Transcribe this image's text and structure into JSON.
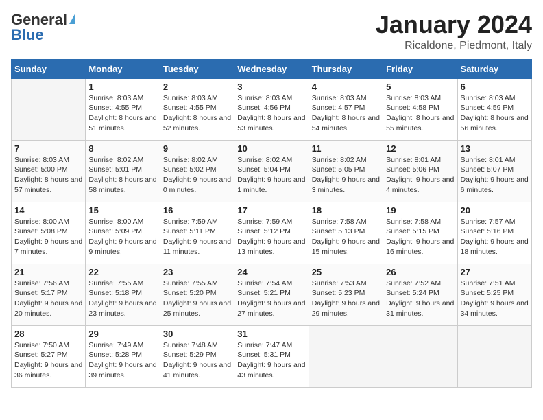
{
  "logo": {
    "general": "General",
    "blue": "Blue",
    "tagline": "GeneralBlue"
  },
  "header": {
    "month": "January 2024",
    "location": "Ricaldone, Piedmont, Italy"
  },
  "weekdays": [
    "Sunday",
    "Monday",
    "Tuesday",
    "Wednesday",
    "Thursday",
    "Friday",
    "Saturday"
  ],
  "weeks": [
    [
      {
        "day": "",
        "sunrise": "",
        "sunset": "",
        "daylight": "",
        "empty": true
      },
      {
        "day": "1",
        "sunrise": "Sunrise: 8:03 AM",
        "sunset": "Sunset: 4:55 PM",
        "daylight": "Daylight: 8 hours and 51 minutes.",
        "empty": false
      },
      {
        "day": "2",
        "sunrise": "Sunrise: 8:03 AM",
        "sunset": "Sunset: 4:55 PM",
        "daylight": "Daylight: 8 hours and 52 minutes.",
        "empty": false
      },
      {
        "day": "3",
        "sunrise": "Sunrise: 8:03 AM",
        "sunset": "Sunset: 4:56 PM",
        "daylight": "Daylight: 8 hours and 53 minutes.",
        "empty": false
      },
      {
        "day": "4",
        "sunrise": "Sunrise: 8:03 AM",
        "sunset": "Sunset: 4:57 PM",
        "daylight": "Daylight: 8 hours and 54 minutes.",
        "empty": false
      },
      {
        "day": "5",
        "sunrise": "Sunrise: 8:03 AM",
        "sunset": "Sunset: 4:58 PM",
        "daylight": "Daylight: 8 hours and 55 minutes.",
        "empty": false
      },
      {
        "day": "6",
        "sunrise": "Sunrise: 8:03 AM",
        "sunset": "Sunset: 4:59 PM",
        "daylight": "Daylight: 8 hours and 56 minutes.",
        "empty": false
      }
    ],
    [
      {
        "day": "7",
        "sunrise": "Sunrise: 8:03 AM",
        "sunset": "Sunset: 5:00 PM",
        "daylight": "Daylight: 8 hours and 57 minutes.",
        "empty": false
      },
      {
        "day": "8",
        "sunrise": "Sunrise: 8:02 AM",
        "sunset": "Sunset: 5:01 PM",
        "daylight": "Daylight: 8 hours and 58 minutes.",
        "empty": false
      },
      {
        "day": "9",
        "sunrise": "Sunrise: 8:02 AM",
        "sunset": "Sunset: 5:02 PM",
        "daylight": "Daylight: 9 hours and 0 minutes.",
        "empty": false
      },
      {
        "day": "10",
        "sunrise": "Sunrise: 8:02 AM",
        "sunset": "Sunset: 5:04 PM",
        "daylight": "Daylight: 9 hours and 1 minute.",
        "empty": false
      },
      {
        "day": "11",
        "sunrise": "Sunrise: 8:02 AM",
        "sunset": "Sunset: 5:05 PM",
        "daylight": "Daylight: 9 hours and 3 minutes.",
        "empty": false
      },
      {
        "day": "12",
        "sunrise": "Sunrise: 8:01 AM",
        "sunset": "Sunset: 5:06 PM",
        "daylight": "Daylight: 9 hours and 4 minutes.",
        "empty": false
      },
      {
        "day": "13",
        "sunrise": "Sunrise: 8:01 AM",
        "sunset": "Sunset: 5:07 PM",
        "daylight": "Daylight: 9 hours and 6 minutes.",
        "empty": false
      }
    ],
    [
      {
        "day": "14",
        "sunrise": "Sunrise: 8:00 AM",
        "sunset": "Sunset: 5:08 PM",
        "daylight": "Daylight: 9 hours and 7 minutes.",
        "empty": false
      },
      {
        "day": "15",
        "sunrise": "Sunrise: 8:00 AM",
        "sunset": "Sunset: 5:09 PM",
        "daylight": "Daylight: 9 hours and 9 minutes.",
        "empty": false
      },
      {
        "day": "16",
        "sunrise": "Sunrise: 7:59 AM",
        "sunset": "Sunset: 5:11 PM",
        "daylight": "Daylight: 9 hours and 11 minutes.",
        "empty": false
      },
      {
        "day": "17",
        "sunrise": "Sunrise: 7:59 AM",
        "sunset": "Sunset: 5:12 PM",
        "daylight": "Daylight: 9 hours and 13 minutes.",
        "empty": false
      },
      {
        "day": "18",
        "sunrise": "Sunrise: 7:58 AM",
        "sunset": "Sunset: 5:13 PM",
        "daylight": "Daylight: 9 hours and 15 minutes.",
        "empty": false
      },
      {
        "day": "19",
        "sunrise": "Sunrise: 7:58 AM",
        "sunset": "Sunset: 5:15 PM",
        "daylight": "Daylight: 9 hours and 16 minutes.",
        "empty": false
      },
      {
        "day": "20",
        "sunrise": "Sunrise: 7:57 AM",
        "sunset": "Sunset: 5:16 PM",
        "daylight": "Daylight: 9 hours and 18 minutes.",
        "empty": false
      }
    ],
    [
      {
        "day": "21",
        "sunrise": "Sunrise: 7:56 AM",
        "sunset": "Sunset: 5:17 PM",
        "daylight": "Daylight: 9 hours and 20 minutes.",
        "empty": false
      },
      {
        "day": "22",
        "sunrise": "Sunrise: 7:55 AM",
        "sunset": "Sunset: 5:18 PM",
        "daylight": "Daylight: 9 hours and 23 minutes.",
        "empty": false
      },
      {
        "day": "23",
        "sunrise": "Sunrise: 7:55 AM",
        "sunset": "Sunset: 5:20 PM",
        "daylight": "Daylight: 9 hours and 25 minutes.",
        "empty": false
      },
      {
        "day": "24",
        "sunrise": "Sunrise: 7:54 AM",
        "sunset": "Sunset: 5:21 PM",
        "daylight": "Daylight: 9 hours and 27 minutes.",
        "empty": false
      },
      {
        "day": "25",
        "sunrise": "Sunrise: 7:53 AM",
        "sunset": "Sunset: 5:23 PM",
        "daylight": "Daylight: 9 hours and 29 minutes.",
        "empty": false
      },
      {
        "day": "26",
        "sunrise": "Sunrise: 7:52 AM",
        "sunset": "Sunset: 5:24 PM",
        "daylight": "Daylight: 9 hours and 31 minutes.",
        "empty": false
      },
      {
        "day": "27",
        "sunrise": "Sunrise: 7:51 AM",
        "sunset": "Sunset: 5:25 PM",
        "daylight": "Daylight: 9 hours and 34 minutes.",
        "empty": false
      }
    ],
    [
      {
        "day": "28",
        "sunrise": "Sunrise: 7:50 AM",
        "sunset": "Sunset: 5:27 PM",
        "daylight": "Daylight: 9 hours and 36 minutes.",
        "empty": false
      },
      {
        "day": "29",
        "sunrise": "Sunrise: 7:49 AM",
        "sunset": "Sunset: 5:28 PM",
        "daylight": "Daylight: 9 hours and 39 minutes.",
        "empty": false
      },
      {
        "day": "30",
        "sunrise": "Sunrise: 7:48 AM",
        "sunset": "Sunset: 5:29 PM",
        "daylight": "Daylight: 9 hours and 41 minutes.",
        "empty": false
      },
      {
        "day": "31",
        "sunrise": "Sunrise: 7:47 AM",
        "sunset": "Sunset: 5:31 PM",
        "daylight": "Daylight: 9 hours and 43 minutes.",
        "empty": false
      },
      {
        "day": "",
        "sunrise": "",
        "sunset": "",
        "daylight": "",
        "empty": true
      },
      {
        "day": "",
        "sunrise": "",
        "sunset": "",
        "daylight": "",
        "empty": true
      },
      {
        "day": "",
        "sunrise": "",
        "sunset": "",
        "daylight": "",
        "empty": true
      }
    ]
  ]
}
